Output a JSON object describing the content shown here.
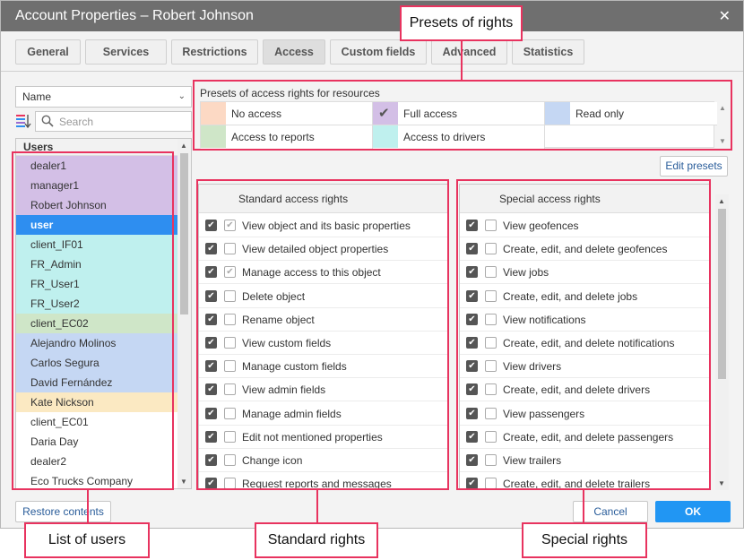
{
  "window": {
    "title": "Account Properties – Robert Johnson",
    "close_icon": "✕"
  },
  "tabs": [
    {
      "label": "General"
    },
    {
      "label": "Services"
    },
    {
      "label": "Restrictions"
    },
    {
      "label": "Access",
      "active": true
    },
    {
      "label": "Custom fields"
    },
    {
      "label": "Advanced"
    },
    {
      "label": "Statistics"
    }
  ],
  "sort": {
    "selected": "Name"
  },
  "search": {
    "placeholder": "Search"
  },
  "users": {
    "header": "Users",
    "items": [
      {
        "name": "dealer1",
        "color": "#d3bfe6"
      },
      {
        "name": "manager1",
        "color": "#d3bfe6"
      },
      {
        "name": "Robert Johnson",
        "color": "#d3bfe6"
      },
      {
        "name": "user",
        "color": "#2e8ef0",
        "selected": true
      },
      {
        "name": "client_IF01",
        "color": "#bff0ee"
      },
      {
        "name": "FR_Admin",
        "color": "#bff0ee"
      },
      {
        "name": "FR_User1",
        "color": "#bff0ee"
      },
      {
        "name": "FR_User2",
        "color": "#bff0ee"
      },
      {
        "name": "client_EC02",
        "color": "#cfe6c8"
      },
      {
        "name": "Alejandro Molinos",
        "color": "#c5d7f3"
      },
      {
        "name": "Carlos Segura",
        "color": "#c5d7f3"
      },
      {
        "name": "David Fernández",
        "color": "#c5d7f3"
      },
      {
        "name": "Kate Nickson",
        "color": "#fbe9c2"
      },
      {
        "name": "client_EC01",
        "color": "#ffffff"
      },
      {
        "name": "Daria Day",
        "color": "#ffffff"
      },
      {
        "name": "dealer2",
        "color": "#ffffff"
      },
      {
        "name": "Eco Trucks Company",
        "color": "#ffffff"
      }
    ]
  },
  "presets": {
    "title": "Presets of access rights for resources",
    "items": [
      {
        "label": "No access",
        "color": "#fcd9c4"
      },
      {
        "label": "Full access",
        "color": "#d3bfe6",
        "checked": true
      },
      {
        "label": "Read only",
        "color": "#c5d7f3"
      },
      {
        "label": "Access to reports",
        "color": "#cfe6c8"
      },
      {
        "label": "Access to drivers",
        "color": "#bff0ee"
      }
    ],
    "edit_label": "Edit presets"
  },
  "standard_rights": {
    "header": "Standard access rights",
    "items": [
      {
        "label": "View object and its basic properties",
        "second": "grey"
      },
      {
        "label": "View detailed object properties",
        "second": "empty"
      },
      {
        "label": "Manage access to this object",
        "second": "grey"
      },
      {
        "label": "Delete object",
        "second": "empty"
      },
      {
        "label": "Rename object",
        "second": "empty"
      },
      {
        "label": "View custom fields",
        "second": "empty"
      },
      {
        "label": "Manage custom fields",
        "second": "empty"
      },
      {
        "label": "View admin fields",
        "second": "empty"
      },
      {
        "label": "Manage admin fields",
        "second": "empty"
      },
      {
        "label": "Edit not mentioned properties",
        "second": "empty"
      },
      {
        "label": "Change icon",
        "second": "empty"
      },
      {
        "label": "Request reports and messages",
        "second": "empty"
      }
    ]
  },
  "special_rights": {
    "header": "Special access rights",
    "items": [
      {
        "label": "View geofences"
      },
      {
        "label": "Create, edit, and delete geofences"
      },
      {
        "label": "View jobs"
      },
      {
        "label": "Create, edit, and delete jobs"
      },
      {
        "label": "View notifications"
      },
      {
        "label": "Create, edit, and delete notifications"
      },
      {
        "label": "View drivers"
      },
      {
        "label": "Create, edit, and delete drivers"
      },
      {
        "label": "View passengers"
      },
      {
        "label": "Create, edit, and delete passengers"
      },
      {
        "label": "View trailers"
      },
      {
        "label": "Create, edit, and delete trailers"
      }
    ]
  },
  "footer": {
    "restore_label": "Restore contents",
    "cancel_label": "Cancel",
    "ok_label": "OK"
  },
  "callouts": {
    "presets": "Presets of rights",
    "users": "List of users",
    "standard": "Standard rights",
    "special": "Special rights"
  },
  "accent_color": "#e8335f"
}
